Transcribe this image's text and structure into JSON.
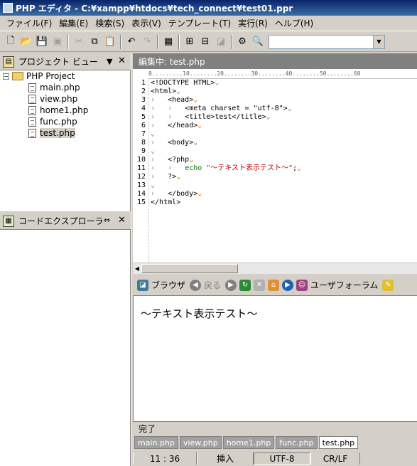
{
  "window": {
    "title": "PHP エディタ - C:¥xampp¥htdocs¥tech_connect¥test01.ppr"
  },
  "menu": {
    "items": [
      "ファイル(F)",
      "編集(E)",
      "検索(S)",
      "表示(V)",
      "テンプレート(T)",
      "実行(R)",
      "ヘルプ(H)"
    ]
  },
  "toolbar": {
    "search_value": ""
  },
  "project_view": {
    "title": "プロジェクト ビュー",
    "root": "PHP Project",
    "files": [
      "main.php",
      "view.php",
      "home1.php",
      "func.php",
      "test.php"
    ],
    "selected": "test.php"
  },
  "code_explorer": {
    "title": "コードエクスプローラ"
  },
  "editor": {
    "header": "編集中: test.php",
    "ruler": "0.........10........20........30........40........50........60",
    "line_numbers": [
      "1",
      "2",
      "3",
      "4",
      "5",
      "6",
      "7",
      "8",
      "9",
      "10",
      "11",
      "12",
      "13",
      "14",
      "15"
    ],
    "lines": [
      "<!DOCTYPE HTML>",
      "<html>",
      "    <head>",
      "        <meta charset = \"utf-8\">",
      "        <title>test</title>",
      "    </head>",
      "",
      "    <body>",
      "",
      "    <?php",
      "        echo \"～テキスト表示テスト～\";",
      "    ?>",
      "",
      "    </body>",
      "</html>"
    ]
  },
  "browser": {
    "toolbar": {
      "browser_label": "ブラウザ",
      "back_label": "戻る",
      "userform_label": "ユーザフォーラム"
    },
    "content": "～テキスト表示テスト～",
    "status": "完了"
  },
  "file_tabs": {
    "items": [
      "main.php",
      "view.php",
      "home1.php",
      "func.php",
      "test.php"
    ],
    "active": "test.php"
  },
  "statusbar": {
    "position": "11 : 36",
    "mode": "挿入",
    "encoding": "UTF-8",
    "line_ending": "CR/LF"
  },
  "colors": {
    "title_bar": "#0a246a",
    "chrome": "#d4d0c8",
    "editor_header": "#808080",
    "echo_keyword": "#008000",
    "string": "#c00000",
    "eol_marker": "#e07000"
  }
}
